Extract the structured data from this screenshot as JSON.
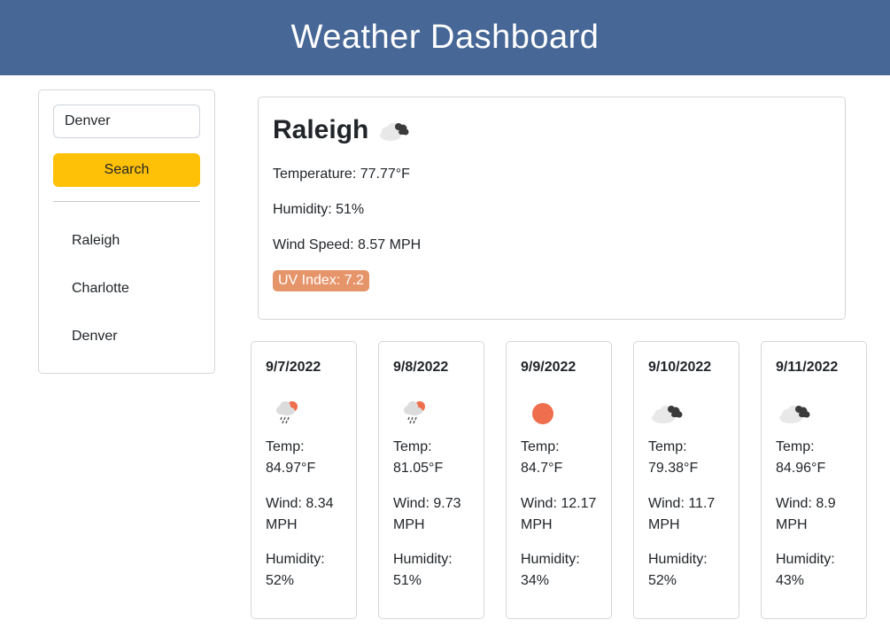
{
  "header": {
    "title": "Weather Dashboard"
  },
  "search": {
    "input_value": "Denver",
    "button_label": "Search"
  },
  "history": [
    "Raleigh",
    "Charlotte",
    "Denver"
  ],
  "current": {
    "city": "Raleigh",
    "icon": "broken-clouds-icon",
    "temperature": "Temperature: 77.77°F",
    "humidity": "Humidity: 51%",
    "wind": "Wind Speed: 8.57 MPH",
    "uv": "UV Index: 7.2",
    "uv_color": "#e6956b"
  },
  "forecast": [
    {
      "date": "9/7/2022",
      "icon": "rain-sun-icon",
      "temp_label": "Temp:",
      "temp": "84.97°F",
      "wind_label": "Wind: 8.34",
      "wind_unit": "MPH",
      "humidity_label": "Humidity:",
      "humidity": "52%"
    },
    {
      "date": "9/8/2022",
      "icon": "rain-sun-icon",
      "temp_label": "Temp:",
      "temp": "81.05°F",
      "wind_label": "Wind: 9.73",
      "wind_unit": "MPH",
      "humidity_label": "Humidity:",
      "humidity": "51%"
    },
    {
      "date": "9/9/2022",
      "icon": "sun-icon",
      "temp_label": "Temp:",
      "temp": "84.7°F",
      "wind_label": "Wind: 12.17",
      "wind_unit": "MPH",
      "humidity_label": "Humidity:",
      "humidity": "34%"
    },
    {
      "date": "9/10/2022",
      "icon": "broken-clouds-icon",
      "temp_label": "Temp:",
      "temp": "79.38°F",
      "wind_label": "Wind: 11.7",
      "wind_unit": "MPH",
      "humidity_label": "Humidity:",
      "humidity": "52%"
    },
    {
      "date": "9/11/2022",
      "icon": "broken-clouds-icon",
      "temp_label": "Temp:",
      "temp": "84.96°F",
      "wind_label": "Wind: 8.9",
      "wind_unit": "MPH",
      "humidity_label": "Humidity:",
      "humidity": "43%"
    }
  ],
  "colors": {
    "header_bg": "#476797",
    "search_button": "#ffc107",
    "sun": "#ee6e4d"
  }
}
